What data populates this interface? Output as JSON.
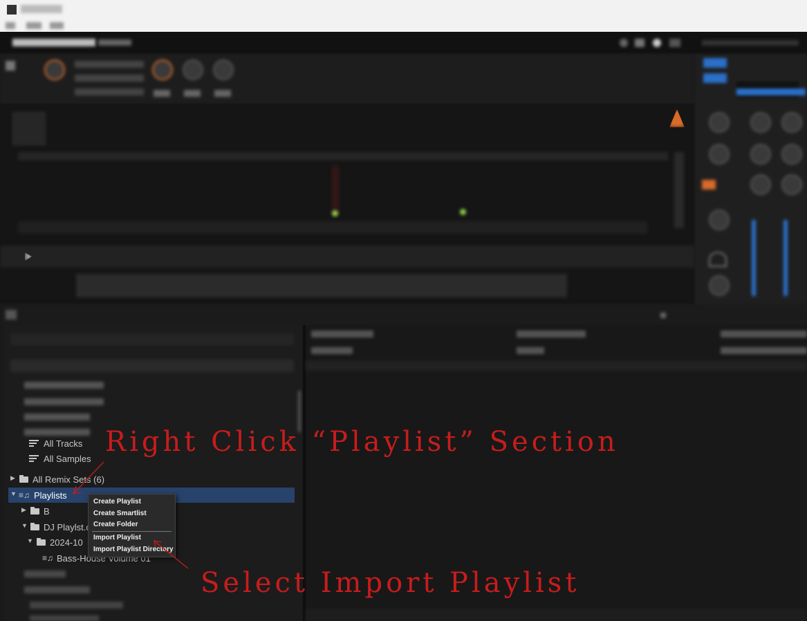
{
  "tree": {
    "items": [
      {
        "label": "All Tracks",
        "icon": "list-icon"
      },
      {
        "label": "All Samples",
        "icon": "list-icon"
      },
      {
        "label": "All Remix Sets (6)",
        "icon": "folder-icon"
      },
      {
        "label": "Playlists",
        "icon": "playlist-icon"
      },
      {
        "label": "B",
        "icon": "folder-icon"
      },
      {
        "label": "DJ Playlst.co",
        "icon": "folder-icon"
      },
      {
        "label": "2024-10",
        "icon": "folder-icon"
      },
      {
        "label": "Bass-House Volume 01",
        "icon": "playlist-icon"
      }
    ]
  },
  "context_menu": {
    "items": [
      "Create Playlist",
      "Create Smartlist",
      "Create Folder",
      "Import Playlist",
      "Import Playlist Directory"
    ]
  },
  "annotations": {
    "top": "Right Click “Playlist” Section",
    "bottom": "Select Import Playlist",
    "color": "#c81c1c"
  },
  "colors": {
    "selection": "#27426b",
    "accent": "#2a6fc9",
    "orange": "#d86a2a"
  }
}
